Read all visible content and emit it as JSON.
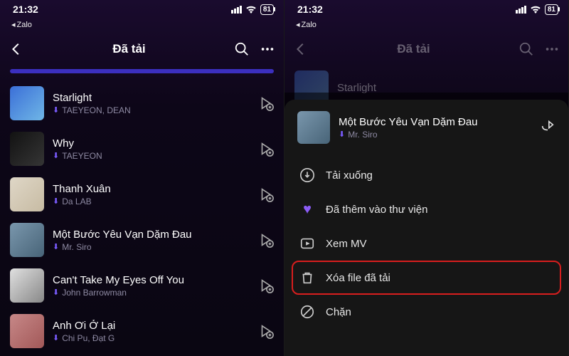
{
  "status": {
    "time": "21:32",
    "battery": "81"
  },
  "back_app": "Zalo",
  "left": {
    "title": "Đã tải",
    "songs": [
      {
        "title": "Starlight",
        "artist": "TAEYEON, DEAN"
      },
      {
        "title": "Why",
        "artist": "TAEYEON"
      },
      {
        "title": "Thanh Xuân",
        "artist": "Da LAB"
      },
      {
        "title": "Một Bước Yêu Vạn Dặm Đau",
        "artist": "Mr. Siro"
      },
      {
        "title": "Can't Take My Eyes Off You",
        "artist": "John Barrowman"
      },
      {
        "title": "Anh Ơi Ở Lại",
        "artist": "Chi Pu, Đạt G"
      }
    ]
  },
  "right": {
    "title": "Đã tải",
    "peek_song": "Starlight",
    "sheet_song": {
      "title": "Một Bước Yêu Vạn Dặm Đau",
      "artist": "Mr. Siro"
    },
    "options": {
      "download": "Tải xuống",
      "added": "Đã thêm vào thư viện",
      "watch_mv": "Xem MV",
      "delete": "Xóa file đã tải",
      "block": "Chặn"
    }
  }
}
